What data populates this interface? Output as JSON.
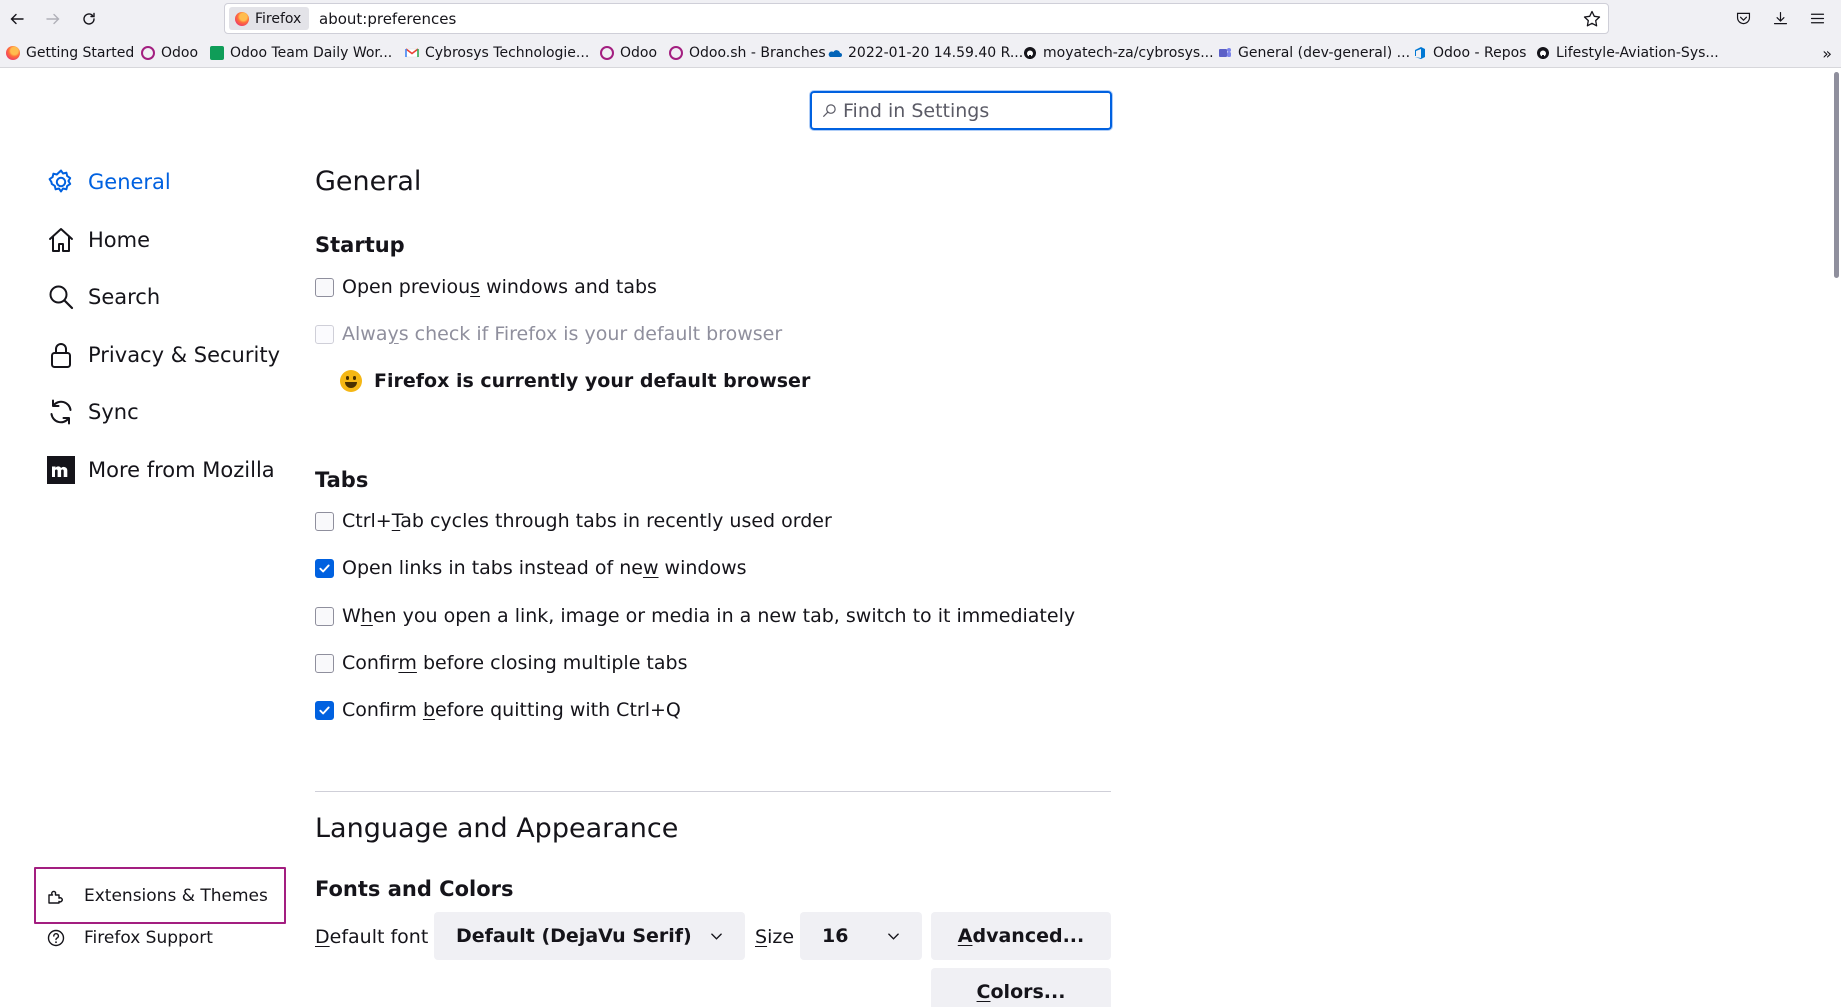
{
  "browser": {
    "identity_label": "Firefox",
    "url": "about:preferences",
    "bookmarks": [
      {
        "label": "Getting Started",
        "icon": "firefox-icon"
      },
      {
        "label": "Odoo",
        "icon": "odoo-icon"
      },
      {
        "label": "Odoo Team Daily Wor...",
        "icon": "sheets-icon"
      },
      {
        "label": "Cybrosys Technologie...",
        "icon": "gmail-icon"
      },
      {
        "label": "Odoo",
        "icon": "odoo-icon"
      },
      {
        "label": "Odoo.sh - Branches",
        "icon": "odoo-icon"
      },
      {
        "label": "2022-01-20 14.59.40 R...",
        "icon": "onedrive-icon"
      },
      {
        "label": "moyatech-za/cybrosys...",
        "icon": "github-icon"
      },
      {
        "label": "General (dev-general) ...",
        "icon": "teams-icon"
      },
      {
        "label": "Odoo - Repos",
        "icon": "azure-devops-icon"
      },
      {
        "label": "Lifestyle-Aviation-Sys...",
        "icon": "github-icon"
      }
    ]
  },
  "search": {
    "placeholder": "Find in Settings"
  },
  "sidebar": {
    "categories": [
      {
        "label": "General",
        "icon": "gear-icon",
        "selected": true
      },
      {
        "label": "Home",
        "icon": "home-icon"
      },
      {
        "label": "Search",
        "icon": "search-icon"
      },
      {
        "label": "Privacy & Security",
        "icon": "lock-icon"
      },
      {
        "label": "Sync",
        "icon": "sync-icon"
      },
      {
        "label": "More from Mozilla",
        "icon": "mozilla-icon"
      }
    ],
    "footer": [
      {
        "label": "Extensions & Themes",
        "icon": "puzzle-icon"
      },
      {
        "label": "Firefox Support",
        "icon": "help-icon"
      }
    ]
  },
  "main": {
    "title": "General",
    "startup": {
      "heading": "Startup",
      "options": [
        {
          "pre": "Open previou",
          "key": "s",
          "post": " windows and tabs",
          "checked": false,
          "disabled": false
        },
        {
          "pre": "Alwa",
          "key": "y",
          "post": "s check if Firefox is your default browser",
          "checked": false,
          "disabled": true
        }
      ],
      "default_message": "Firefox is currently your default browser"
    },
    "tabs": {
      "heading": "Tabs",
      "options": [
        {
          "pre": "Ctrl+",
          "key": "T",
          "post": "ab cycles through tabs in recently used order",
          "checked": false
        },
        {
          "pre": "Open links in tabs instead of ne",
          "key": "w",
          "post": " windows",
          "checked": true
        },
        {
          "pre": "W",
          "key": "h",
          "post": "en you open a link, image or media in a new tab, switch to it immediately",
          "checked": false
        },
        {
          "pre": "Confir",
          "key": "m",
          "post": " before closing multiple tabs",
          "checked": false
        },
        {
          "pre": "Confirm ",
          "key": "b",
          "post": "efore quitting with Ctrl+Q",
          "checked": true
        }
      ]
    },
    "language": {
      "title": "Language and Appearance",
      "fonts_heading": "Fonts and Colors",
      "default_font_key": "D",
      "default_font_rest": "efault font",
      "default_font_value": "Default (DejaVu Serif)",
      "size_key": "S",
      "size_rest": "ize",
      "size_value": "16",
      "advanced_key": "A",
      "advanced_rest": "dvanced...",
      "colors_key": "C",
      "colors_rest": "olors..."
    }
  },
  "colors": {
    "accent": "#0061e0",
    "focus_outline": "#a31e80"
  }
}
